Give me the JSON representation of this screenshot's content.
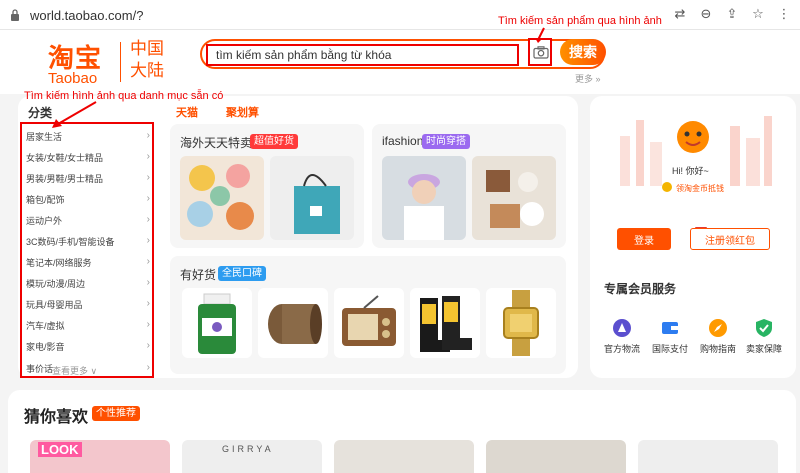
{
  "browser": {
    "url": "world.taobao.com/?"
  },
  "header": {
    "logo_main": "淘宝",
    "logo_sub": "Taobao",
    "logo_region_1": "中国",
    "logo_region_2": "大陆",
    "search_placeholder": "tìm kiếm sản phẩm bằng từ khóa",
    "search_button": "搜索",
    "more_link": "更多 »"
  },
  "annotations": {
    "image_search": "Tìm kiếm sản phẩm qua hình ảnh",
    "category_search": "Tìm kiếm hình ảnh qua danh mục sẵn có"
  },
  "nav": {
    "category_title": "分类",
    "tmall": "天猫",
    "juhuasuan": "聚划算"
  },
  "categories": [
    "居家生活",
    "女装/女鞋/女士精品",
    "男装/男鞋/男士精品",
    "箱包/配饰",
    "运动户外",
    "3C数码/手机/智能设备",
    "笔记本/网络服务",
    "模玩/动漫/周边",
    "玩具/母婴用品",
    "汽车/虚拟",
    "家电/影音",
    "事价话"
  ],
  "category_more": "查看更多 ∨",
  "cards": {
    "haiwai": {
      "title": "海外天天特卖",
      "tag": "超值好货"
    },
    "ifashion": {
      "title": "ifashion",
      "tag": "时尚穿搭"
    },
    "youhao": {
      "title": "有好货",
      "tag": "全民口碑"
    }
  },
  "user": {
    "greeting": "Hi! 你好~",
    "coupon": "领淘金币抵钱",
    "login": "登录",
    "register": "注册领红包"
  },
  "member": {
    "title": "专属会员服务",
    "services": [
      {
        "label": "官方物流",
        "icon": "rocket-icon",
        "color": "#5b4fcf"
      },
      {
        "label": "国际支付",
        "icon": "wallet-icon",
        "color": "#2d7cf0"
      },
      {
        "label": "购物指南",
        "icon": "compass-icon",
        "color": "#ff9a00"
      },
      {
        "label": "卖家保障",
        "icon": "shield-icon",
        "color": "#28b463"
      }
    ]
  },
  "guess": {
    "title": "猜你喜欢",
    "tag": "个性推荐",
    "thumb_look": "LOOK",
    "thumb_brand": "GIRRYA"
  },
  "colors": {
    "brand": "#ff5000",
    "annotation": "#ee0000"
  }
}
